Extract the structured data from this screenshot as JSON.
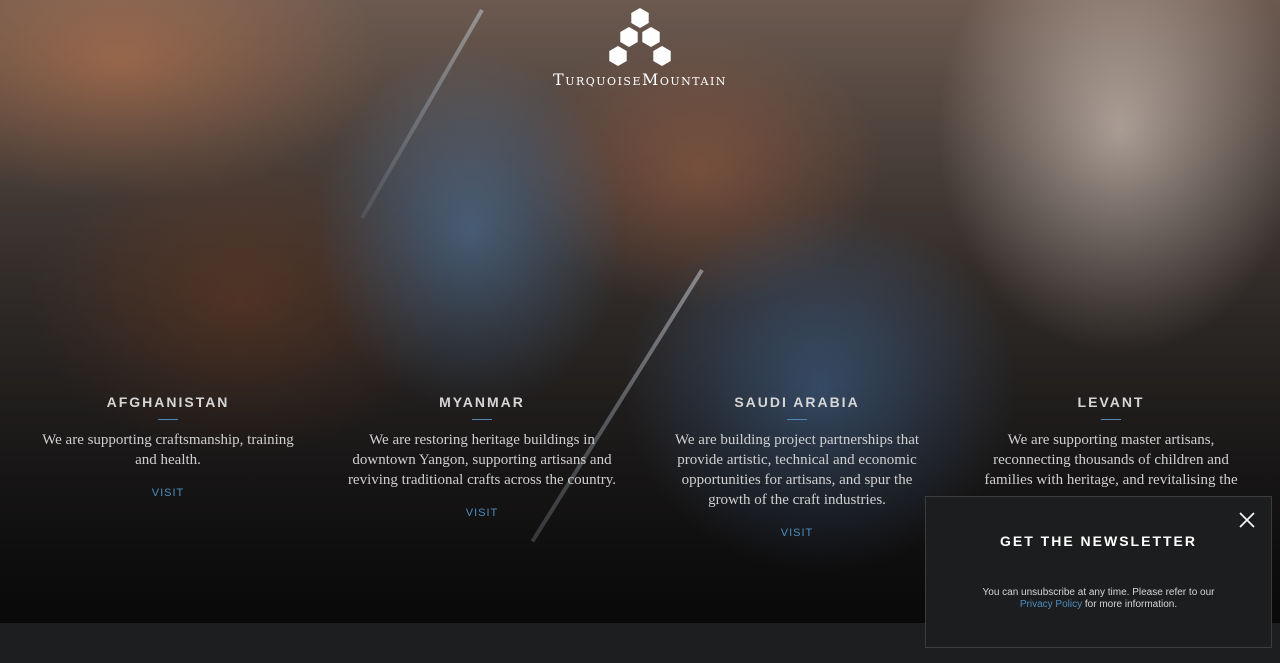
{
  "brand": {
    "name": "TurquoiseMountain"
  },
  "regions": [
    {
      "name": "AFGHANISTAN",
      "description": "We are supporting craftsmanship, training and health.",
      "link": "VISIT"
    },
    {
      "name": "MYANMAR",
      "description": "We are restoring heritage buildings in downtown Yangon, supporting artisans and reviving traditional crafts across the country.",
      "link": "VISIT"
    },
    {
      "name": "SAUDI ARABIA",
      "description": "We are building project partnerships that provide artistic, technical and economic opportunities for artisans, and spur the growth of the craft industries.",
      "link": "VISIT"
    },
    {
      "name": "LEVANT",
      "description": "We are supporting master artisans, reconnecting thousands of children and families with heritage, and revitalising the",
      "link": ""
    }
  ],
  "newsletter": {
    "title": "GET THE NEWSLETTER",
    "note_prefix": "You can unsubscribe at any time. Please refer to our",
    "privacy_link": "Privacy Policy",
    "note_suffix": "for more information.",
    "close_icon": "close-icon"
  },
  "colors": {
    "accent": "#4d8cc0",
    "popup_bg": "#1c1d1e"
  }
}
